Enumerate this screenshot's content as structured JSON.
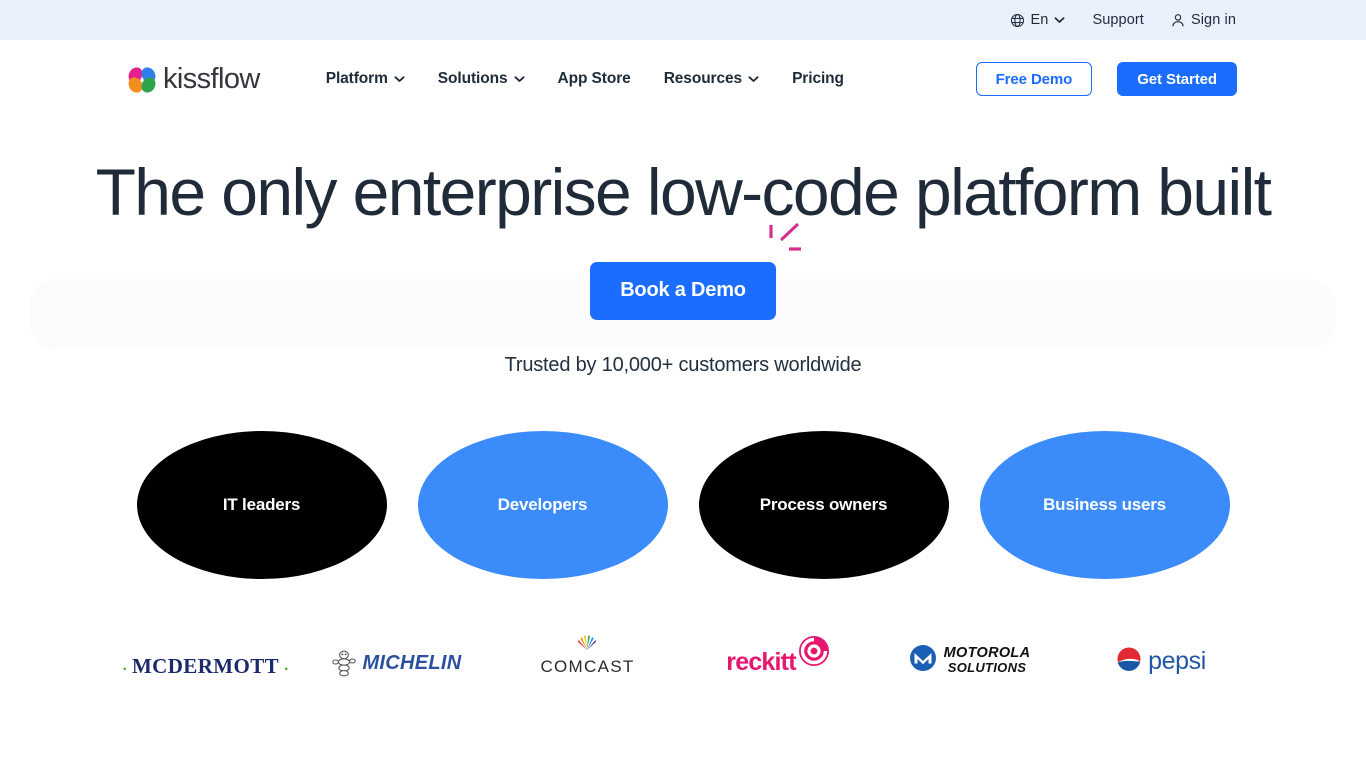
{
  "topbar": {
    "language": "En",
    "language_icon": "globe-icon",
    "language_chevron": "chevron-down-icon",
    "support": "Support",
    "signin": "Sign in",
    "signin_icon": "user-icon",
    "background": "#eaf1fc"
  },
  "nav": {
    "brand": "kissflow",
    "brand_icon": "kissflow-butterfly-logo",
    "links": [
      {
        "label": "Platform",
        "has_dropdown": true
      },
      {
        "label": "Solutions",
        "has_dropdown": true
      },
      {
        "label": "App Store",
        "has_dropdown": false
      },
      {
        "label": "Resources",
        "has_dropdown": true
      },
      {
        "label": "Pricing",
        "has_dropdown": false
      }
    ],
    "free_demo": "Free Demo",
    "get_started": "Get Started",
    "accent": "#1a6dff"
  },
  "hero": {
    "headline": "The only enterprise low-code platform built",
    "cta": "Book a Demo",
    "cta_sparkle_icon": "sparkle-lines-icon",
    "sparkle_color": "#d6308f",
    "trusted": "Trusted by 10,000+ customers worldwide"
  },
  "personas": [
    {
      "label": "IT leaders",
      "style": "dark",
      "color": "#000000"
    },
    {
      "label": "Developers",
      "style": "blue",
      "color": "#3b8bfb"
    },
    {
      "label": "Process owners",
      "style": "dark",
      "color": "#000000"
    },
    {
      "label": "Business users",
      "style": "blue",
      "color": "#3b8bfb"
    }
  ],
  "client_logos": [
    {
      "name": "MCDERMOTT",
      "icon": "mcdermott-logo"
    },
    {
      "name": "MICHELIN",
      "icon": "michelin-logo"
    },
    {
      "name": "COMCAST",
      "icon": "comcast-peacock-logo"
    },
    {
      "name": "reckitt",
      "icon": "reckitt-logo"
    },
    {
      "name": "MOTOROLA",
      "name2": "SOLUTIONS",
      "icon": "motorola-solutions-logo"
    },
    {
      "name": "pepsi",
      "icon": "pepsi-logo"
    }
  ]
}
